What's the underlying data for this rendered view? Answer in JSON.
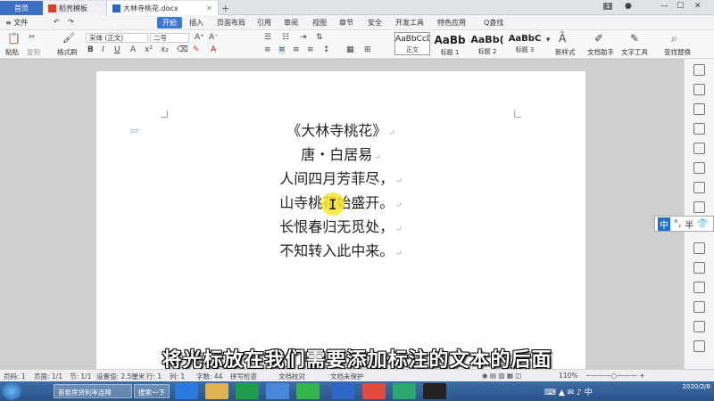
{
  "titlebar": {
    "tabs": [
      {
        "label": "首页"
      },
      {
        "label": "稻壳模板"
      },
      {
        "label": "大林寺桃花.docx"
      }
    ],
    "badge": "1"
  },
  "menubar": {
    "file": "文件",
    "items": [
      "开始",
      "插入",
      "页面布局",
      "引用",
      "审阅",
      "视图",
      "章节",
      "安全",
      "开发工具",
      "特色应用"
    ],
    "search": "Q查找"
  },
  "toolbar": {
    "paste": "粘贴",
    "copy": "复制",
    "format_painter": "格式刷",
    "font_name": "宋体 (正文)",
    "font_size": "二号",
    "styles": [
      {
        "preview": "AaBbCcDd",
        "name": "正文"
      },
      {
        "preview": "AaBb",
        "name": "标题 1"
      },
      {
        "preview": "AaBb(",
        "name": "标题 2"
      },
      {
        "preview": "AaBbC",
        "name": "标题 3"
      }
    ],
    "new_style": "新样式",
    "doc_helper": "文档助手",
    "text_tools": "文字工具",
    "find_replace": "查找替换"
  },
  "document": {
    "lines": [
      "《大林寺桃花》",
      "唐・白居易",
      "人间四月芳菲尽，",
      "山寺桃花始盛开。",
      "长恨春归无觅处，",
      "不知转入此中来。"
    ]
  },
  "ime": {
    "mode": "中",
    "punct": "°,",
    "width": "半"
  },
  "subtitle": "将光标放在我们需要添加标注的文本的后面",
  "statusbar": {
    "page": "页码: 1",
    "pages": "页面: 1/1",
    "section": "节: 1/1",
    "setting": "设置值: 2.5厘米",
    "row": "行: 1",
    "col": "列: 1",
    "wordcount": "字数: 44",
    "spellcheck": "拼写检查",
    "doc_proof": "文档校对",
    "unprotected": "文档未保护",
    "zoom": "110%"
  },
  "taskbar": {
    "window1": "首套房贷利率连降",
    "window2": "搜索一下",
    "date": "2020/2/8"
  }
}
